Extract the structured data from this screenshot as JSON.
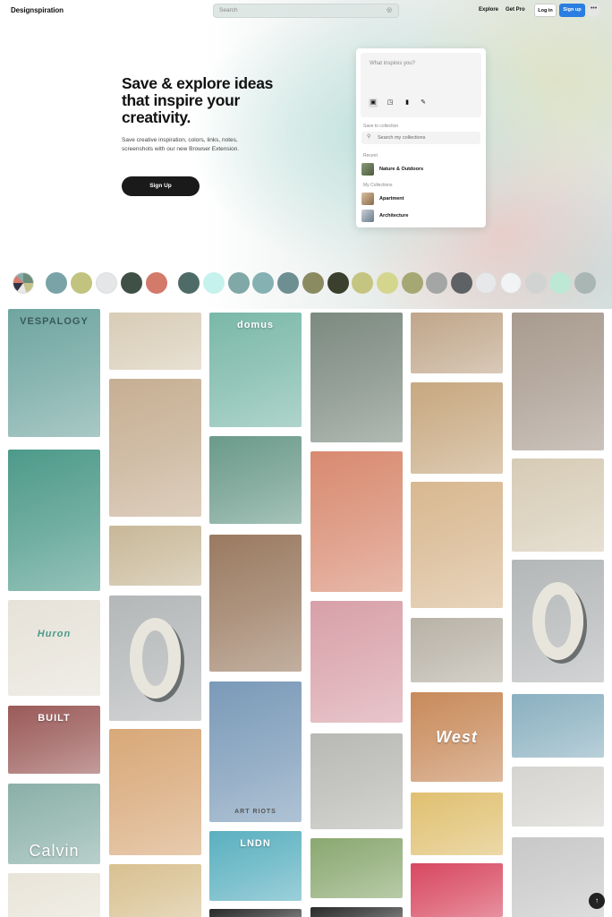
{
  "header": {
    "logo": "Designspiration",
    "search_placeholder": "Search",
    "nav": {
      "explore": "Explore",
      "get_pro": "Get Pro"
    },
    "login": "Log in",
    "signup": "Sign up",
    "more": "•••"
  },
  "hero": {
    "title": "Save & explore ideas that inspire your creativity.",
    "subtitle": "Save creative inspiration, colors, links, notes, screenshots with our new Browser Extension.",
    "cta": "Sign Up"
  },
  "extension": {
    "input_placeholder": "What inspires you?",
    "save_to_label": "Save to collection",
    "search_placeholder": "Search my collections",
    "recent_label": "Recent",
    "recent": [
      {
        "label": "Nature & Outdoors",
        "color": "#6a7a5a"
      }
    ],
    "my_collections_label": "My Collections",
    "collections": [
      {
        "label": "Apartment",
        "color": "#b89a78"
      },
      {
        "label": "Architecture",
        "color": "#8a9aa8"
      }
    ]
  },
  "colors": [
    "#7aa3a7",
    "#c1c37f",
    "#e4e6e8",
    "#3f5146",
    "#d47a6a",
    "#4f6b68",
    "#c6f2ee",
    "#7fa8a6",
    "#85b1b2",
    "#6e8f92",
    "#8b8b62",
    "#3b3f2e",
    "#c5c582",
    "#d4d68e",
    "#a6a873",
    "#a4a6a6",
    "#5f6264",
    "#e6e8ea",
    "#f1f3f4",
    "#d1d3d3",
    "#bde8d6",
    "#a9b6b4"
  ],
  "grid_items": [
    {
      "name": "vespalogy-poster",
      "label": "VESPALOGY",
      "color": "#6fa5a0"
    },
    {
      "name": "desk-top-view",
      "color": "#d8ccb6"
    },
    {
      "name": "domus-magazine",
      "label": "domus",
      "color": "#7ab8a8"
    },
    {
      "name": "stormy-sea-print",
      "color": "#7c8a80"
    },
    {
      "name": "loft-interior",
      "color": "#c0a68a"
    },
    {
      "name": "hexagon-tiles",
      "color": "#a89a8e"
    },
    {
      "name": "mountain-poster",
      "color": "#4d9a8a"
    },
    {
      "name": "office-lamp",
      "color": "#c6ae92"
    },
    {
      "name": "man-flowers-illustration",
      "color": "#6a9a8a"
    },
    {
      "name": "woven-textile",
      "color": "#d88a70"
    },
    {
      "name": "book-spines",
      "color": "#c7a880"
    },
    {
      "name": "tulips-vase",
      "color": "#d6cbb5"
    },
    {
      "name": "pattern-cards",
      "color": "#c8b898"
    },
    {
      "name": "bread-tree-illustration",
      "color": "#d8b890"
    },
    {
      "name": "huron-tshirt",
      "label": "Huron",
      "color": "#e6e2d8"
    },
    {
      "name": "letter-o-3d",
      "color": "#b4b7b8"
    },
    {
      "name": "european-street",
      "color": "#9a7a60"
    },
    {
      "name": "watercolor-landscape",
      "color": "#d8a0a8"
    },
    {
      "name": "stationery-mockup",
      "color": "#b8b2a6"
    },
    {
      "name": "letter-o-3d-2",
      "color": "#b4b7b8"
    },
    {
      "name": "built-poster",
      "label": "BUILT",
      "color": "#9a5a58"
    },
    {
      "name": "triangle-poster",
      "color": "#d8a878"
    },
    {
      "name": "art-riots",
      "label": "ART RIOTS",
      "color": "#7a9ab8"
    },
    {
      "name": "west-cats",
      "label": "West",
      "color": "#c88a5a"
    },
    {
      "name": "bedroom-interior",
      "color": "#8ab0c0"
    },
    {
      "name": "calvin-tshirt",
      "label": "Calvin",
      "color": "#8ab0a8"
    },
    {
      "name": "fashion-model",
      "color": "#b8b8b4"
    },
    {
      "name": "business-cards",
      "color": "#e0c070"
    },
    {
      "name": "white-interior",
      "color": "#d6d4d0"
    },
    {
      "name": "london-illustration",
      "label": "LNDN",
      "color": "#5ab0c0"
    },
    {
      "name": "door-hanger",
      "color": "#8aa870"
    },
    {
      "name": "skull-art",
      "color": "#d8c090"
    },
    {
      "name": "hand-lettering",
      "color": "#e8e4d8"
    },
    {
      "name": "colorful-notebook",
      "color": "#d84860"
    },
    {
      "name": "sneakers",
      "color": "#c8c8c8"
    },
    {
      "name": "dark-poster",
      "color": "#2a2a2a"
    }
  ],
  "scroll_top": "↑"
}
